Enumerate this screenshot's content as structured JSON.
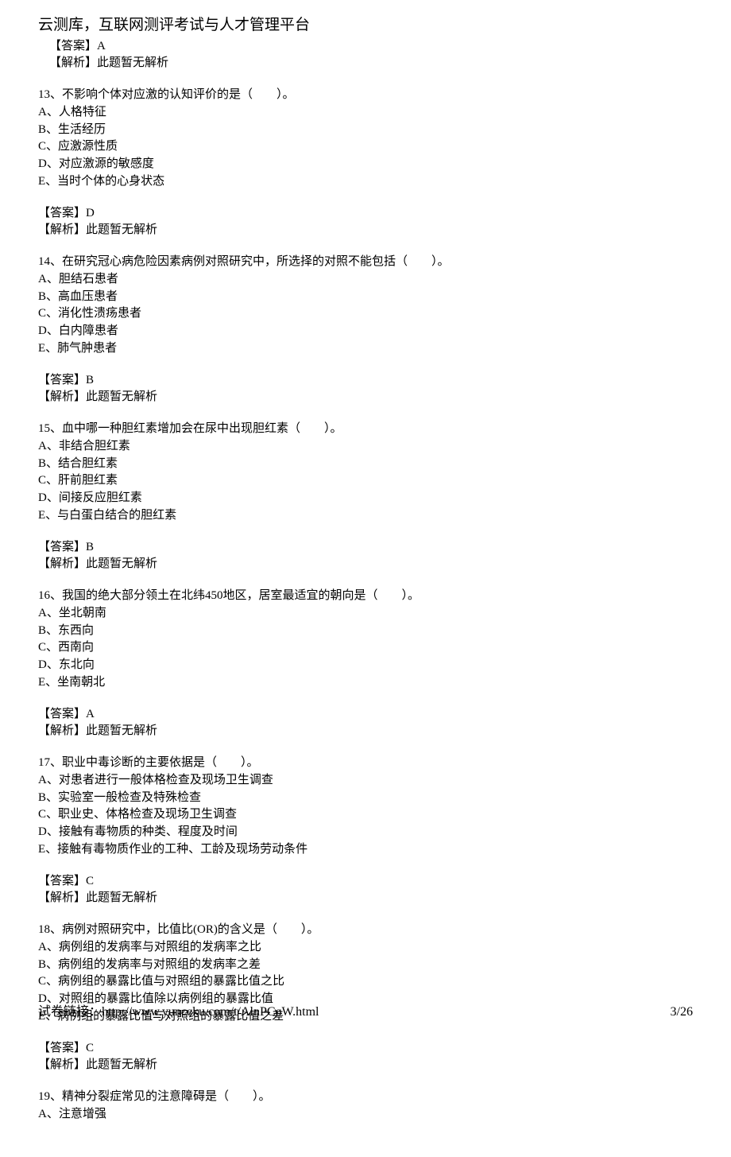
{
  "header": {
    "title": "云测库，互联网测评考试与人才管理平台"
  },
  "q12_answer": {
    "answer_label": "【答案】",
    "answer_value": "A",
    "analysis_label": "【解析】",
    "analysis_value": "此题暂无解析"
  },
  "questions": [
    {
      "number": "13、",
      "stem": "不影响个体对应激的认知评价的是（　　）。",
      "options": [
        "A、人格特征",
        "B、生活经历",
        "C、应激源性质",
        "D、对应激源的敏感度",
        "E、当时个体的心身状态"
      ],
      "answer_label": "【答案】",
      "answer_value": "D",
      "analysis_label": "【解析】",
      "analysis_value": "此题暂无解析"
    },
    {
      "number": "14、",
      "stem": "在研究冠心病危险因素病例对照研究中，所选择的对照不能包括（　　）。",
      "options": [
        "A、胆结石患者",
        "B、高血压患者",
        "C、消化性溃疡患者",
        "D、白内障患者",
        "E、肺气肿患者"
      ],
      "answer_label": "【答案】",
      "answer_value": "B",
      "analysis_label": "【解析】",
      "analysis_value": "此题暂无解析"
    },
    {
      "number": "15、",
      "stem": "血中哪一种胆红素增加会在尿中出现胆红素（　　）。",
      "options": [
        "A、非结合胆红素",
        "B、结合胆红素",
        "C、肝前胆红素",
        "D、间接反应胆红素",
        "E、与白蛋白结合的胆红素"
      ],
      "answer_label": "【答案】",
      "answer_value": "B",
      "analysis_label": "【解析】",
      "analysis_value": "此题暂无解析"
    },
    {
      "number": "16、",
      "stem": "我国的绝大部分领土在北纬450地区，居室最适宜的朝向是（　　）。",
      "options": [
        "A、坐北朝南",
        "B、东西向",
        "C、西南向",
        "D、东北向",
        "E、坐南朝北"
      ],
      "answer_label": "【答案】",
      "answer_value": "A",
      "analysis_label": "【解析】",
      "analysis_value": "此题暂无解析"
    },
    {
      "number": "17、",
      "stem": "职业中毒诊断的主要依据是（　　）。",
      "options": [
        "A、对患者进行一般体格检查及现场卫生调查",
        "B、实验室一般检查及特殊检查",
        "C、职业史、体格检查及现场卫生调查",
        "D、接触有毒物质的种类、程度及时间",
        "E、接触有毒物质作业的工种、工龄及现场劳动条件"
      ],
      "answer_label": "【答案】",
      "answer_value": "C",
      "analysis_label": "【解析】",
      "analysis_value": "此题暂无解析"
    },
    {
      "number": "18、",
      "stem": "病例对照研究中，比值比(OR)的含义是（　　）。",
      "options": [
        "A、病例组的发病率与对照组的发病率之比",
        "B、病例组的发病率与对照组的发病率之差",
        "C、病例组的暴露比值与对照组的暴露比值之比",
        "D、对照组的暴露比值除以病例组的暴露比值",
        "E、病例组的暴露比值与对照组的暴露比值之差"
      ],
      "answer_label": "【答案】",
      "answer_value": "C",
      "analysis_label": "【解析】",
      "analysis_value": "此题暂无解析"
    }
  ],
  "q19_partial": {
    "number": "19、",
    "stem": "精神分裂症常见的注意障碍是（　　）。",
    "options": [
      "A、注意增强"
    ]
  },
  "footer": {
    "link_label": "试卷链接：",
    "link_url": "http://www.yunceku.com/t/AlnPCoW.html",
    "page": "3/26"
  }
}
